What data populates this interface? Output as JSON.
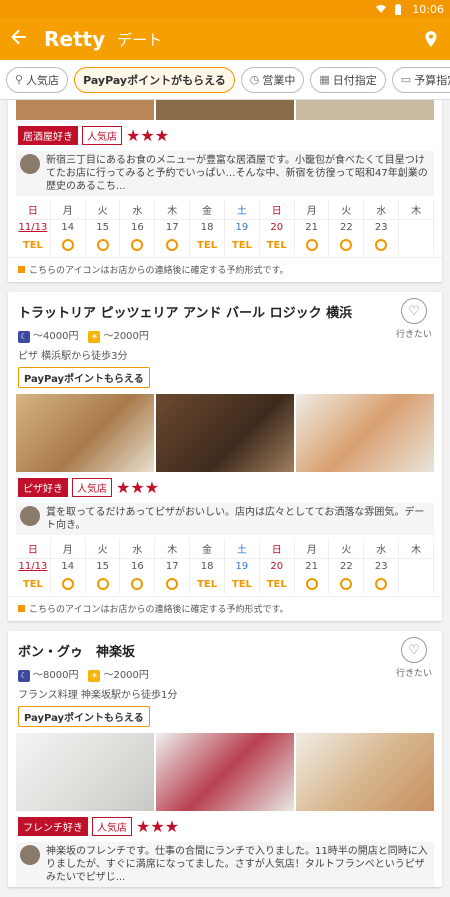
{
  "status": {
    "time": "10:06"
  },
  "appbar": {
    "brand": "Retty",
    "title": "デート"
  },
  "filters": [
    {
      "label": "人気店",
      "icon": "cutlery-icon"
    },
    {
      "label": "PayPayポイントがもらえる",
      "icon": ""
    },
    {
      "label": "営業中",
      "icon": "clock-icon"
    },
    {
      "label": "日付指定",
      "icon": "calendar-icon"
    },
    {
      "label": "予算指定",
      "icon": "wallet-icon"
    }
  ],
  "calendar": {
    "dows": [
      "日",
      "月",
      "火",
      "水",
      "木",
      "金",
      "土",
      "日",
      "月",
      "火",
      "水",
      "木"
    ],
    "dates": [
      "11/13",
      "14",
      "15",
      "16",
      "17",
      "18",
      "19",
      "20",
      "21",
      "22",
      "23",
      ""
    ],
    "slots": [
      "TEL",
      "○",
      "○",
      "○",
      "○",
      "TEL",
      "TEL",
      "TEL",
      "○",
      "○",
      "○",
      ""
    ]
  },
  "calendar_note": "こちらのアイコンはお店からの連絡後に確定する予約形式です。",
  "cards": [
    {
      "tags": [
        "居酒屋好き",
        "人気店"
      ],
      "stars": "★★★",
      "review": "新宿三丁目にあるお食のメニューが豊富な居酒屋です。小籠包が食べたくて目星つけてたお店に行ってみると予約でいっぱい…そんな中、新宿を彷徨って昭和47年創業の歴史のあるこち..."
    },
    {
      "name": "トラットリア ピッツェリア アンド バール ロジック 横浜",
      "fav": "行きたい",
      "dinner": "～4000円",
      "lunch": "～2000円",
      "area": "ピザ 横浜駅から徒歩3分",
      "paypay": "PayPayポイントもらえる",
      "tags": [
        "ピザ好き",
        "人気店"
      ],
      "stars": "★★★",
      "review": "賞を取ってるだけあってピザがおいしい。店内は広々としててお洒落な雰囲気。デート向き。"
    },
    {
      "name": "ボン・グゥ　神楽坂",
      "fav": "行きたい",
      "dinner": "～8000円",
      "lunch": "～2000円",
      "area": "フランス料理 神楽坂駅から徒歩1分",
      "paypay": "PayPayポイントもらえる",
      "tags": [
        "フレンチ好き",
        "人気店"
      ],
      "stars": "★★★",
      "review": "神楽坂のフレンチです。仕事の合間にランチで入りました。11時半の開店と同時に入りましたが、すぐに満席になってました。さすが人気店！タルトフランベというピザみたいでピザじ..."
    }
  ]
}
